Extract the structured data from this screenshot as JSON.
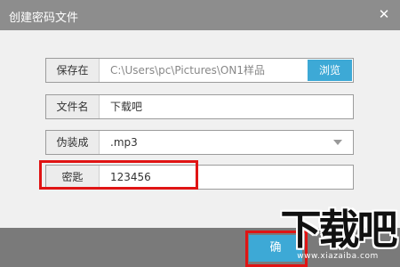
{
  "dialog": {
    "title": "创建密码文件",
    "close_glyph": "✕"
  },
  "form": {
    "save_path": {
      "label": "保存在",
      "value": "C:\\Users\\pc\\Pictures\\ON1样品",
      "browse_label": "浏览"
    },
    "file_name": {
      "label": "文件名",
      "value": "下载吧"
    },
    "disguise_as": {
      "label": "伪装成",
      "value": ".mp3"
    },
    "password": {
      "label": "密匙",
      "value": "123456"
    }
  },
  "footer": {
    "confirm_label": "确"
  },
  "watermark": {
    "logo_text": "下载吧",
    "url_text": "www.xiazaiba.com"
  },
  "colors": {
    "accent": "#3da9d6",
    "highlight": "#e01414",
    "titlebar": "#8d8d8d"
  }
}
